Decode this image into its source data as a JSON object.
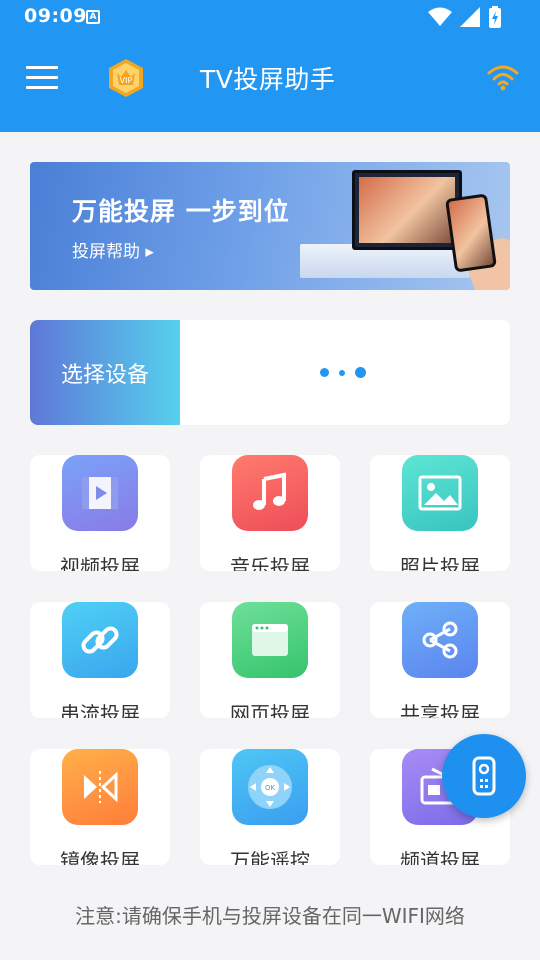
{
  "status_bar": {
    "time": "09:09",
    "a_badge": "A"
  },
  "header": {
    "title": "TV投屏助手",
    "vip_label": "VIP"
  },
  "banner": {
    "headline": "万能投屏 一步到位",
    "help_link": "投屏帮助 ▸"
  },
  "device": {
    "select_label": "选择设备"
  },
  "features": [
    {
      "label": "视频投屏",
      "icon": "video-icon"
    },
    {
      "label": "音乐投屏",
      "icon": "music-icon"
    },
    {
      "label": "照片投屏",
      "icon": "photo-icon"
    },
    {
      "label": "串流投屏",
      "icon": "link-icon"
    },
    {
      "label": "网页投屏",
      "icon": "browser-icon"
    },
    {
      "label": "共享投屏",
      "icon": "share-icon"
    },
    {
      "label": "镜像投屏",
      "icon": "mirror-icon"
    },
    {
      "label": "万能遥控",
      "icon": "remote-dpad-icon"
    },
    {
      "label": "频道投屏",
      "icon": "radio-icon"
    }
  ],
  "fab": {
    "icon": "remote-control-icon"
  },
  "notice": "注意:请确保手机与投屏设备在同一WIFI网络",
  "colors": {
    "primary": "#2196f3",
    "background": "#f4f4f6"
  }
}
